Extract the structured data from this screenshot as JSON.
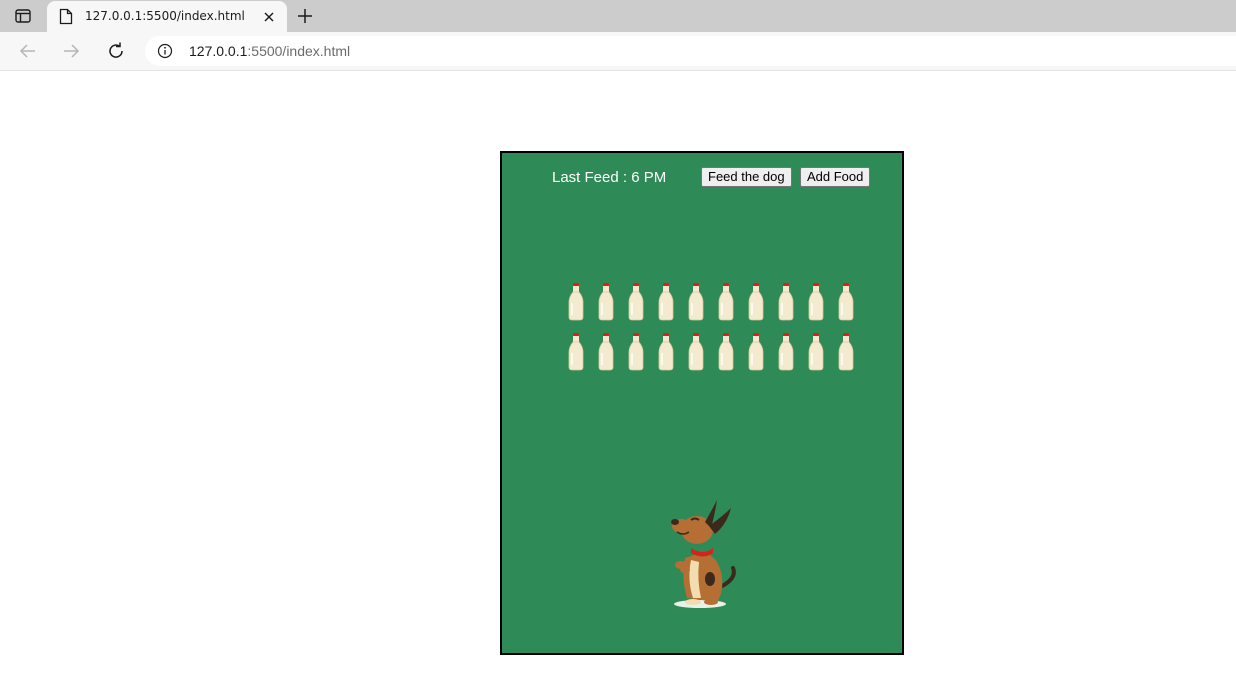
{
  "browser": {
    "tab_title": "127.0.0.1:5500/index.html",
    "url_host": "127.0.0.1",
    "url_path": ":5500/index.html"
  },
  "page": {
    "last_feed_text": "Last Feed : 6 PM",
    "feed_button_label": "Feed the dog",
    "add_food_button_label": "Add Food",
    "milk_rows": 2,
    "milk_per_row": 10,
    "background_color": "#2e8b57"
  }
}
